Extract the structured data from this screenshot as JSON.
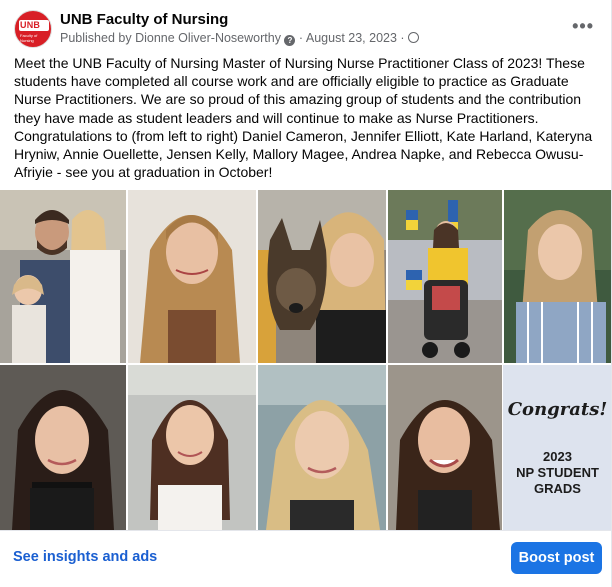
{
  "post": {
    "page_name": "UNB Faculty of Nursing",
    "avatar": {
      "logo_text": "UNB",
      "logo_sub": "Faculty of Nursing"
    },
    "published_prefix": "Published by",
    "publisher": "Dionne Oliver-Noseworthy",
    "question_icon": "question-circle-icon",
    "separator": "·",
    "date": "August 23, 2023",
    "audience_icon": "globe-icon",
    "more_label": "•••",
    "text": "Meet the UNB Faculty of Nursing Master of Nursing Nurse Practitioner Class of 2023! These students have completed all course work and are officially eligible to practice as Graduate Nurse Practitioners. We are so proud of this amazing group of students and the contribution they have made as student leaders and will continue to make as Nurse Practitioners. Congratulations to (from left to right) Daniel Cameron, Jennifer Elliott, Kate Harland, Kateryna Hryniw, Annie Ouellette, Jensen Kelly, Mallory Magee, Andrea Napke, and Rebecca Owusu-Afriyie - see you at graduation in October!",
    "photos": [
      "photo-man-with-two-girls",
      "photo-woman-blonde-curls",
      "photo-woman-with-dog",
      "photo-woman-with-stroller-flags",
      "photo-woman-striped-shirt",
      "photo-woman-dark-hair",
      "photo-woman-white-top",
      "photo-woman-blonde-outdoors",
      "photo-woman-smiling-dark-hair"
    ],
    "congrats_card": {
      "script": "Congrats!",
      "line1": "2023",
      "line2": "NP STUDENT",
      "line3": "GRADS"
    }
  },
  "footer": {
    "insights_label": "See insights and ads",
    "boost_label": "Boost post"
  },
  "colors": {
    "link_blue": "#1a5fd1",
    "boost_blue": "#1b74e4",
    "meta_gray": "#65676b",
    "unb_red": "#d81f26"
  }
}
